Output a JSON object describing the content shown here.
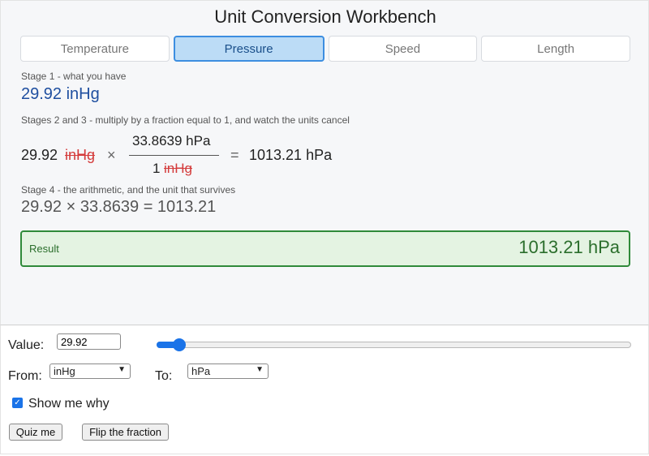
{
  "app": {
    "title": "Unit Conversion Workbench"
  },
  "tabs": [
    {
      "label": "Temperature",
      "active": false
    },
    {
      "label": "Pressure",
      "active": true
    },
    {
      "label": "Speed",
      "active": false
    },
    {
      "label": "Length",
      "active": false
    }
  ],
  "stage1": {
    "label": "Stage 1 - what you have",
    "value": "29.92 inHg"
  },
  "stage23": {
    "label": "Stages 2 and 3 - multiply by a fraction equal to 1, and watch the units cancel",
    "input_number": "29.92",
    "input_unit": "inHg",
    "times": "×",
    "numerator": "33.8639 hPa",
    "denominator_number": "1",
    "denominator_unit": "inHg",
    "equals": "=",
    "result": "1013.21 hPa"
  },
  "stage4": {
    "label": "Stage 4 - the arithmetic, and the unit that survives",
    "expression": "29.92 × 33.8639 = 1013.21"
  },
  "result": {
    "label": "Result",
    "value": "1013.21 hPa"
  },
  "controls": {
    "value_label": "Value:",
    "value": "29.92",
    "slider_level": 0.036,
    "from_label": "From:",
    "from_value": "inHg",
    "to_label": "To:",
    "to_value": "hPa",
    "show_why_label": "Show me why",
    "show_why_checked": true,
    "quiz_label": "Quiz me",
    "flip_label": "Flip the fraction"
  },
  "colors": {
    "accent": "#1a73e8",
    "tab_active_bg": "#bcdcf6",
    "cancel": "#d43b3b",
    "result_green": "#2b6e2c"
  }
}
